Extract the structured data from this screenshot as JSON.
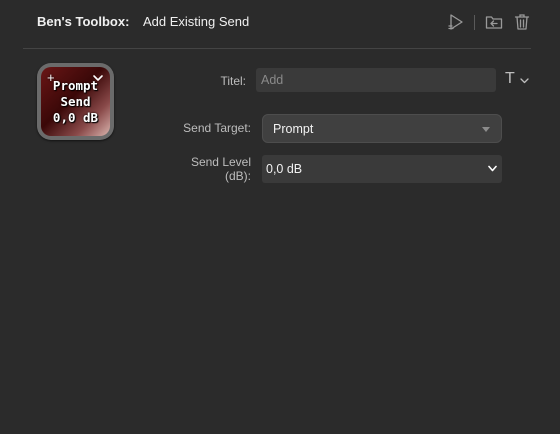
{
  "header": {
    "app_name": "Ben's Toolbox:",
    "action_title": "Add Existing Send",
    "icons": [
      "run-action-icon",
      "import-folder-icon",
      "trash-icon"
    ]
  },
  "tile": {
    "line1": "Prompt",
    "line2": "Send",
    "line3": "0,0 dB",
    "add_glyph": "+",
    "icon": "chevron-down-icon",
    "colors": {
      "dark": "#3a0808",
      "red": "#6a1616",
      "light": "#d9b3ad"
    }
  },
  "form": {
    "title_label": "Titel:",
    "title_placeholder": "Add",
    "title_value": "",
    "text_style_glyph": "T",
    "send_target_label": "Send Target:",
    "send_target_value": "Prompt",
    "send_level_label_line1": "Send Level",
    "send_level_label_line2": "(dB):",
    "send_level_value": "0,0 dB"
  }
}
